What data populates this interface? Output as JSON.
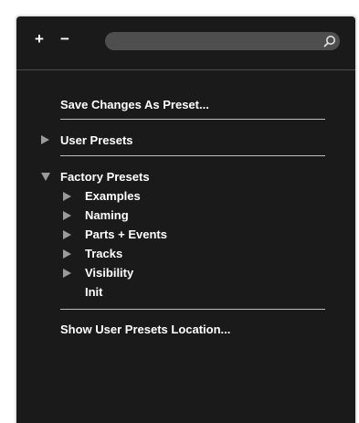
{
  "toolbar": {
    "add_label": "+",
    "remove_label": "−",
    "search_placeholder": "",
    "search_value": "",
    "search_icon": "search-icon"
  },
  "menu": {
    "save_changes": "Save Changes As Preset...",
    "user_presets": "User Presets",
    "factory_presets": "Factory Presets",
    "factory_children": [
      {
        "label": "Examples",
        "expandable": true
      },
      {
        "label": "Naming",
        "expandable": true
      },
      {
        "label": "Parts + Events",
        "expandable": true
      },
      {
        "label": "Tracks",
        "expandable": true
      },
      {
        "label": "Visibility",
        "expandable": true
      },
      {
        "label": "Init",
        "expandable": false
      }
    ],
    "show_location": "Show User Presets Location..."
  },
  "colors": {
    "panel_bg": "#1a1a1a",
    "text": "#ffffff",
    "search_bg": "#4e4e4e",
    "triangle": "#9a9a9a",
    "divider": "#bdbdbd"
  }
}
